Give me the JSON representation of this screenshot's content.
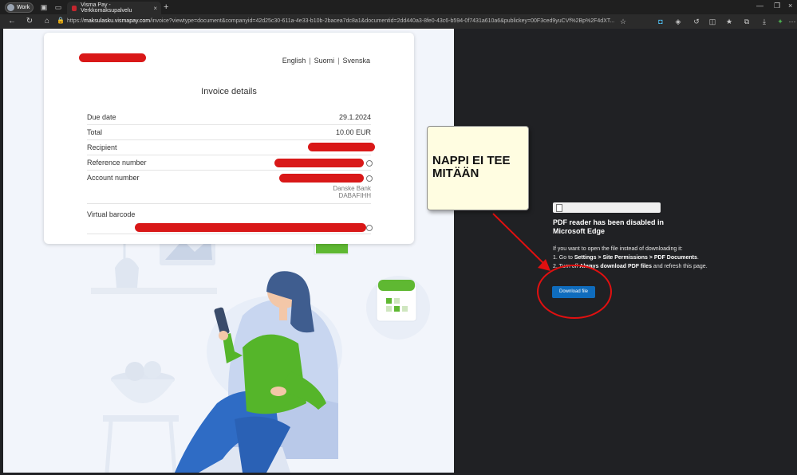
{
  "browser": {
    "profile_label": "Work",
    "tab_title": "Visma Pay - Verkkomaksupalvelu",
    "new_tab_symbol": "+",
    "url_prefix": "https://",
    "url_domain": "maksulasku.vismapay.com",
    "url_path": "/invoice?viewtype=document&companyid=42d25c30-611a-4e33-b10b-2bacea7dc8a1&documentid=2dd440a3-8fe0-43c6-b594-0f7431a610a6&publickey=00F3ced9yuCVf%2Bp%2F4dXT...",
    "icons": [
      "back-icon",
      "refresh-icon",
      "home-icon",
      "star-icon",
      "settings-icon"
    ]
  },
  "invoice": {
    "languages": [
      "English",
      "Suomi",
      "Svenska"
    ],
    "title": "Invoice details",
    "rows": [
      {
        "label": "Due date",
        "value": "29.1.2024"
      },
      {
        "label": "Total",
        "value": "10.00 EUR"
      },
      {
        "label": "Recipient",
        "value": ""
      },
      {
        "label": "Reference number",
        "value": ""
      },
      {
        "label": "Account number",
        "value": ""
      }
    ],
    "bank_name": "Danske Bank",
    "bank_bic": "DABAFIHH",
    "barcode_label": "Virtual barcode",
    "redaction_color": "#d70c0c"
  },
  "pdf_panel": {
    "title": "PDF reader has been disabled in Microsoft Edge",
    "intro": "If you want to open the file instead of downloading it:",
    "step1_a": "1. Go to ",
    "step1_b": "Settings > Site Permissions > PDF Documents",
    "step1_c": ".",
    "step2_a": "2. Turn off ",
    "step2_b": "Always download PDF files",
    "step2_c": " and refresh this page.",
    "download_label": "Download file",
    "accent": "#0f6cbd"
  },
  "annotation": {
    "note_text": "NAPPI EI TEE MITÄÄN",
    "color": "#e01010"
  }
}
